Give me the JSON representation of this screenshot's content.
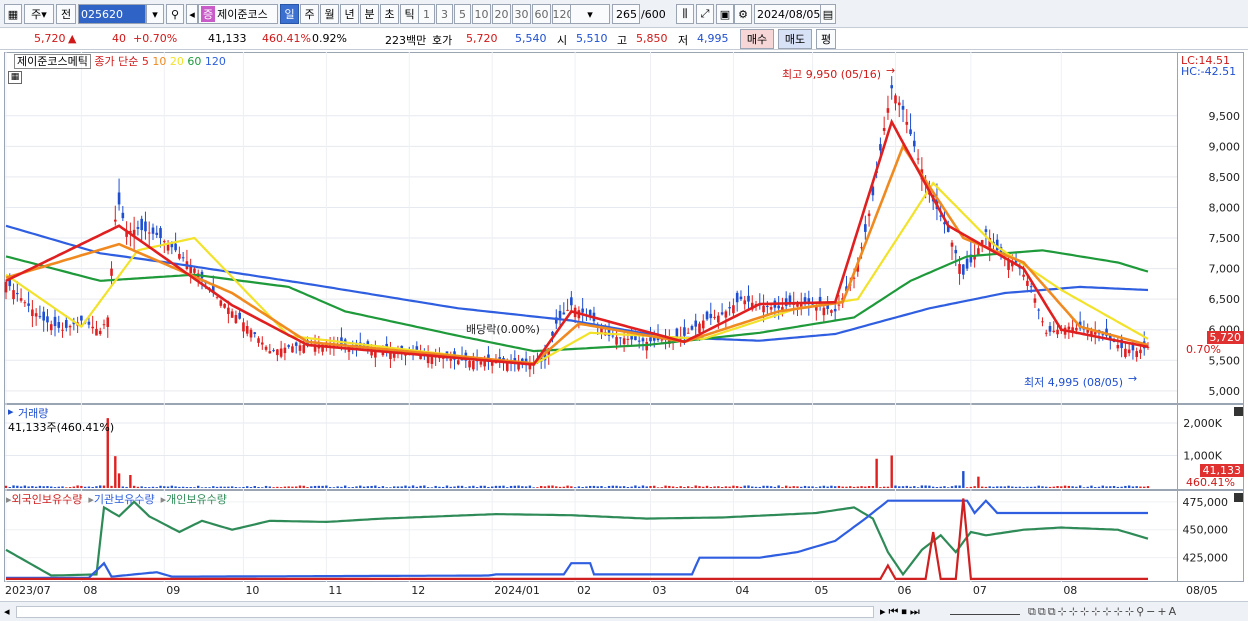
{
  "toolbar": {
    "market": "주",
    "prev_label": "전",
    "code": "025620",
    "stock_name": "제이준코스",
    "period_tabs": [
      "일",
      "주",
      "월",
      "년",
      "분",
      "초",
      "틱"
    ],
    "active_period": "일",
    "minute_opts": [
      "1",
      "3",
      "5",
      "10",
      "20",
      "30",
      "60",
      "120"
    ],
    "count": "265",
    "count_total": "/600",
    "date": "2024/08/05"
  },
  "quote": {
    "price": "5,720",
    "change": "40",
    "change_pct": "+0.70%",
    "volume": "41,133",
    "volume_pct": "460.41%",
    "turnover": "0.92%",
    "value_amount": "223백만",
    "bid_label": "호가",
    "bid": "5,720",
    "ask": "5,540",
    "open_label": "시",
    "open": "5,510",
    "high_label": "고",
    "high": "5,850",
    "low_label": "저",
    "low": "4,995",
    "buy_btn": "매수",
    "sell_btn": "매도",
    "eval_btn": "평"
  },
  "price_panel": {
    "legend_name": "제이준코스메틱",
    "legend_ma": "종가 단순",
    "ma_periods": [
      "5",
      "10",
      "20",
      "60",
      "120"
    ],
    "ma_colors": [
      "#e02020",
      "#f08a20",
      "#f2e22a",
      "#1f9a3a",
      "#2f5fe0"
    ],
    "lc": "LC:14.51",
    "hc": "HC:-42.51",
    "high_note": "최고 9,950 (05/16)",
    "low_note": "최저 4,995 (08/05)",
    "dividend_note": "배당락(0.00%)",
    "price_tag": "5,720",
    "pct_tag": "0.70%"
  },
  "volume_panel": {
    "title": "거래량",
    "sub": "41,133주(460.41%)",
    "tag1": "41,133",
    "tag2": "460.41%"
  },
  "holding_panel": {
    "legend": [
      "외국인보유수량",
      "기관보유수량",
      "개인보유수량"
    ],
    "legend_colors": [
      "#d02020",
      "#2f5fe0",
      "#2e8b57"
    ]
  },
  "chart_data": {
    "type": "candlestick",
    "title": "제이준코스메틱",
    "y_ticks": [
      5000,
      5500,
      6000,
      6500,
      7000,
      7500,
      8000,
      8500,
      9000,
      9500
    ],
    "y_range": [
      4850,
      10380
    ],
    "x_ticks": [
      "2023/07",
      "08",
      "09",
      "10",
      "11",
      "12",
      "2024/01",
      "02",
      "03",
      "04",
      "05",
      "06",
      "07",
      "08",
      "08/05"
    ],
    "close_points": [
      [
        0,
        6780
      ],
      [
        5,
        6450
      ],
      [
        10,
        6150
      ],
      [
        15,
        6000
      ],
      [
        20,
        6150
      ],
      [
        25,
        5980
      ],
      [
        27,
        6200
      ],
      [
        29,
        7800
      ],
      [
        30,
        8050
      ],
      [
        32,
        7600
      ],
      [
        35,
        7650
      ],
      [
        40,
        7550
      ],
      [
        45,
        7300
      ],
      [
        50,
        7000
      ],
      [
        55,
        6600
      ],
      [
        60,
        6300
      ],
      [
        65,
        6000
      ],
      [
        70,
        5650
      ],
      [
        75,
        5720
      ],
      [
        80,
        5760
      ],
      [
        90,
        5750
      ],
      [
        100,
        5650
      ],
      [
        110,
        5600
      ],
      [
        120,
        5500
      ],
      [
        130,
        5470
      ],
      [
        140,
        5430
      ],
      [
        143,
        5500
      ],
      [
        146,
        6100
      ],
      [
        150,
        6400
      ],
      [
        155,
        6200
      ],
      [
        160,
        5900
      ],
      [
        170,
        5800
      ],
      [
        180,
        5900
      ],
      [
        185,
        6150
      ],
      [
        190,
        6250
      ],
      [
        195,
        6500
      ],
      [
        200,
        6400
      ],
      [
        205,
        6350
      ],
      [
        210,
        6450
      ],
      [
        215,
        6400
      ],
      [
        220,
        6300
      ],
      [
        225,
        6850
      ],
      [
        228,
        7600
      ],
      [
        230,
        8200
      ],
      [
        233,
        9300
      ],
      [
        235,
        9950
      ],
      [
        238,
        9600
      ],
      [
        242,
        8800
      ],
      [
        246,
        8100
      ],
      [
        250,
        7600
      ],
      [
        254,
        6900
      ],
      [
        257,
        7200
      ],
      [
        260,
        7600
      ],
      [
        264,
        7200
      ],
      [
        268,
        7100
      ],
      [
        272,
        6700
      ],
      [
        276,
        5950
      ],
      [
        282,
        6050
      ],
      [
        287,
        6000
      ],
      [
        292,
        5900
      ],
      [
        296,
        5700
      ],
      [
        300,
        5650
      ],
      [
        303,
        5720
      ]
    ],
    "ma_anchors": {
      "ma5": [
        [
          0,
          6800
        ],
        [
          30,
          7700
        ],
        [
          60,
          6400
        ],
        [
          80,
          5750
        ],
        [
          140,
          5430
        ],
        [
          150,
          6300
        ],
        [
          180,
          5800
        ],
        [
          200,
          6420
        ],
        [
          220,
          6450
        ],
        [
          235,
          9400
        ],
        [
          250,
          7700
        ],
        [
          270,
          7000
        ],
        [
          280,
          6000
        ],
        [
          303,
          5720
        ]
      ],
      "ma10": [
        [
          0,
          6850
        ],
        [
          30,
          7400
        ],
        [
          60,
          6600
        ],
        [
          80,
          5800
        ],
        [
          140,
          5450
        ],
        [
          152,
          6100
        ],
        [
          180,
          5800
        ],
        [
          205,
          6300
        ],
        [
          222,
          6450
        ],
        [
          238,
          9000
        ],
        [
          254,
          7500
        ],
        [
          270,
          7100
        ],
        [
          285,
          6050
        ],
        [
          303,
          5750
        ]
      ],
      "ma20": [
        [
          0,
          6900
        ],
        [
          20,
          6050
        ],
        [
          35,
          7300
        ],
        [
          50,
          7500
        ],
        [
          75,
          5900
        ],
        [
          140,
          5430
        ],
        [
          155,
          5950
        ],
        [
          185,
          5850
        ],
        [
          210,
          6350
        ],
        [
          226,
          6500
        ],
        [
          246,
          8400
        ],
        [
          262,
          7400
        ],
        [
          280,
          6650
        ],
        [
          303,
          5850
        ]
      ],
      "ma60": [
        [
          0,
          7200
        ],
        [
          25,
          6800
        ],
        [
          50,
          6900
        ],
        [
          75,
          6700
        ],
        [
          90,
          6300
        ],
        [
          120,
          5900
        ],
        [
          140,
          5650
        ],
        [
          170,
          5750
        ],
        [
          200,
          5950
        ],
        [
          225,
          6200
        ],
        [
          240,
          6800
        ],
        [
          255,
          7200
        ],
        [
          275,
          7300
        ],
        [
          295,
          7100
        ],
        [
          303,
          6950
        ]
      ],
      "ma120": [
        [
          0,
          7700
        ],
        [
          25,
          7250
        ],
        [
          45,
          7080
        ],
        [
          80,
          6750
        ],
        [
          120,
          6350
        ],
        [
          150,
          6150
        ],
        [
          175,
          5880
        ],
        [
          200,
          5820
        ],
        [
          220,
          5930
        ],
        [
          245,
          6350
        ],
        [
          265,
          6600
        ],
        [
          285,
          6700
        ],
        [
          303,
          6650
        ]
      ]
    },
    "volume_spikes": [
      [
        27,
        2150000
      ],
      [
        29,
        980000
      ],
      [
        30,
        450000
      ],
      [
        33,
        400000
      ],
      [
        231,
        900000
      ],
      [
        235,
        1000000
      ],
      [
        254,
        520000
      ],
      [
        258,
        350000
      ]
    ],
    "volume_y_ticks": [
      "2,000K",
      "1,000K"
    ],
    "holding_y_ticks": [
      "475,000",
      "450,000",
      "425,000"
    ]
  }
}
